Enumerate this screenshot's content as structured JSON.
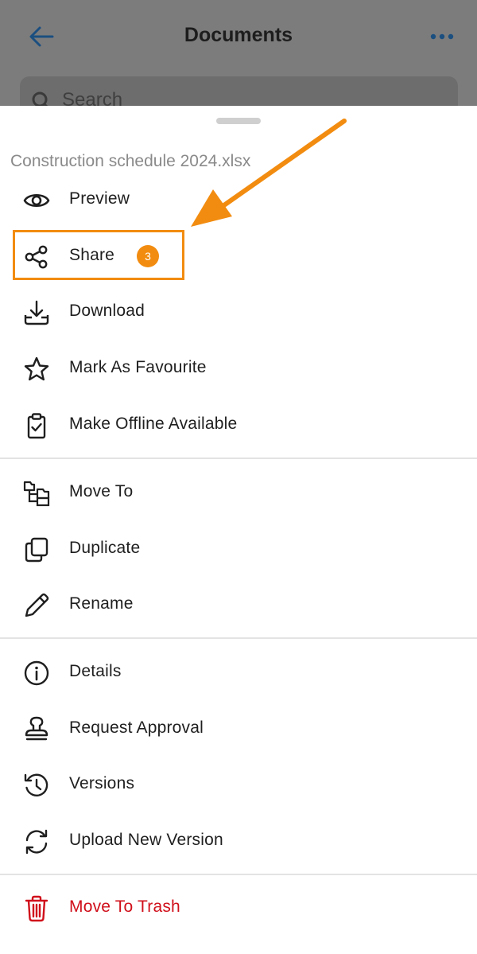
{
  "header": {
    "title": "Documents",
    "search_placeholder": "Search"
  },
  "sheet": {
    "file_name": "Construction schedule 2024.xlsx",
    "groups": [
      {
        "items": [
          {
            "label": "Preview",
            "icon": "eye-icon"
          },
          {
            "label": "Share",
            "icon": "share-icon"
          },
          {
            "label": "Download",
            "icon": "download-icon"
          },
          {
            "label": "Mark As Favourite",
            "icon": "star-icon"
          },
          {
            "label": "Make Offline Available",
            "icon": "clipboard-check-icon"
          }
        ]
      },
      {
        "items": [
          {
            "label": "Move To",
            "icon": "folder-tree-icon"
          },
          {
            "label": "Duplicate",
            "icon": "copy-icon"
          },
          {
            "label": "Rename",
            "icon": "pencil-icon"
          }
        ]
      },
      {
        "items": [
          {
            "label": "Details",
            "icon": "info-icon"
          },
          {
            "label": "Request Approval",
            "icon": "stamp-icon"
          },
          {
            "label": "Versions",
            "icon": "history-icon"
          },
          {
            "label": "Upload New Version",
            "icon": "sync-icon"
          }
        ]
      },
      {
        "items": [
          {
            "label": "Move To Trash",
            "icon": "trash-icon",
            "danger": true
          }
        ]
      }
    ]
  },
  "annotation": {
    "step_number": "3",
    "color": "#f28c10"
  },
  "colors": {
    "accent": "#1a5a9a",
    "danger": "#d0101b",
    "annotation": "#f28c10"
  }
}
